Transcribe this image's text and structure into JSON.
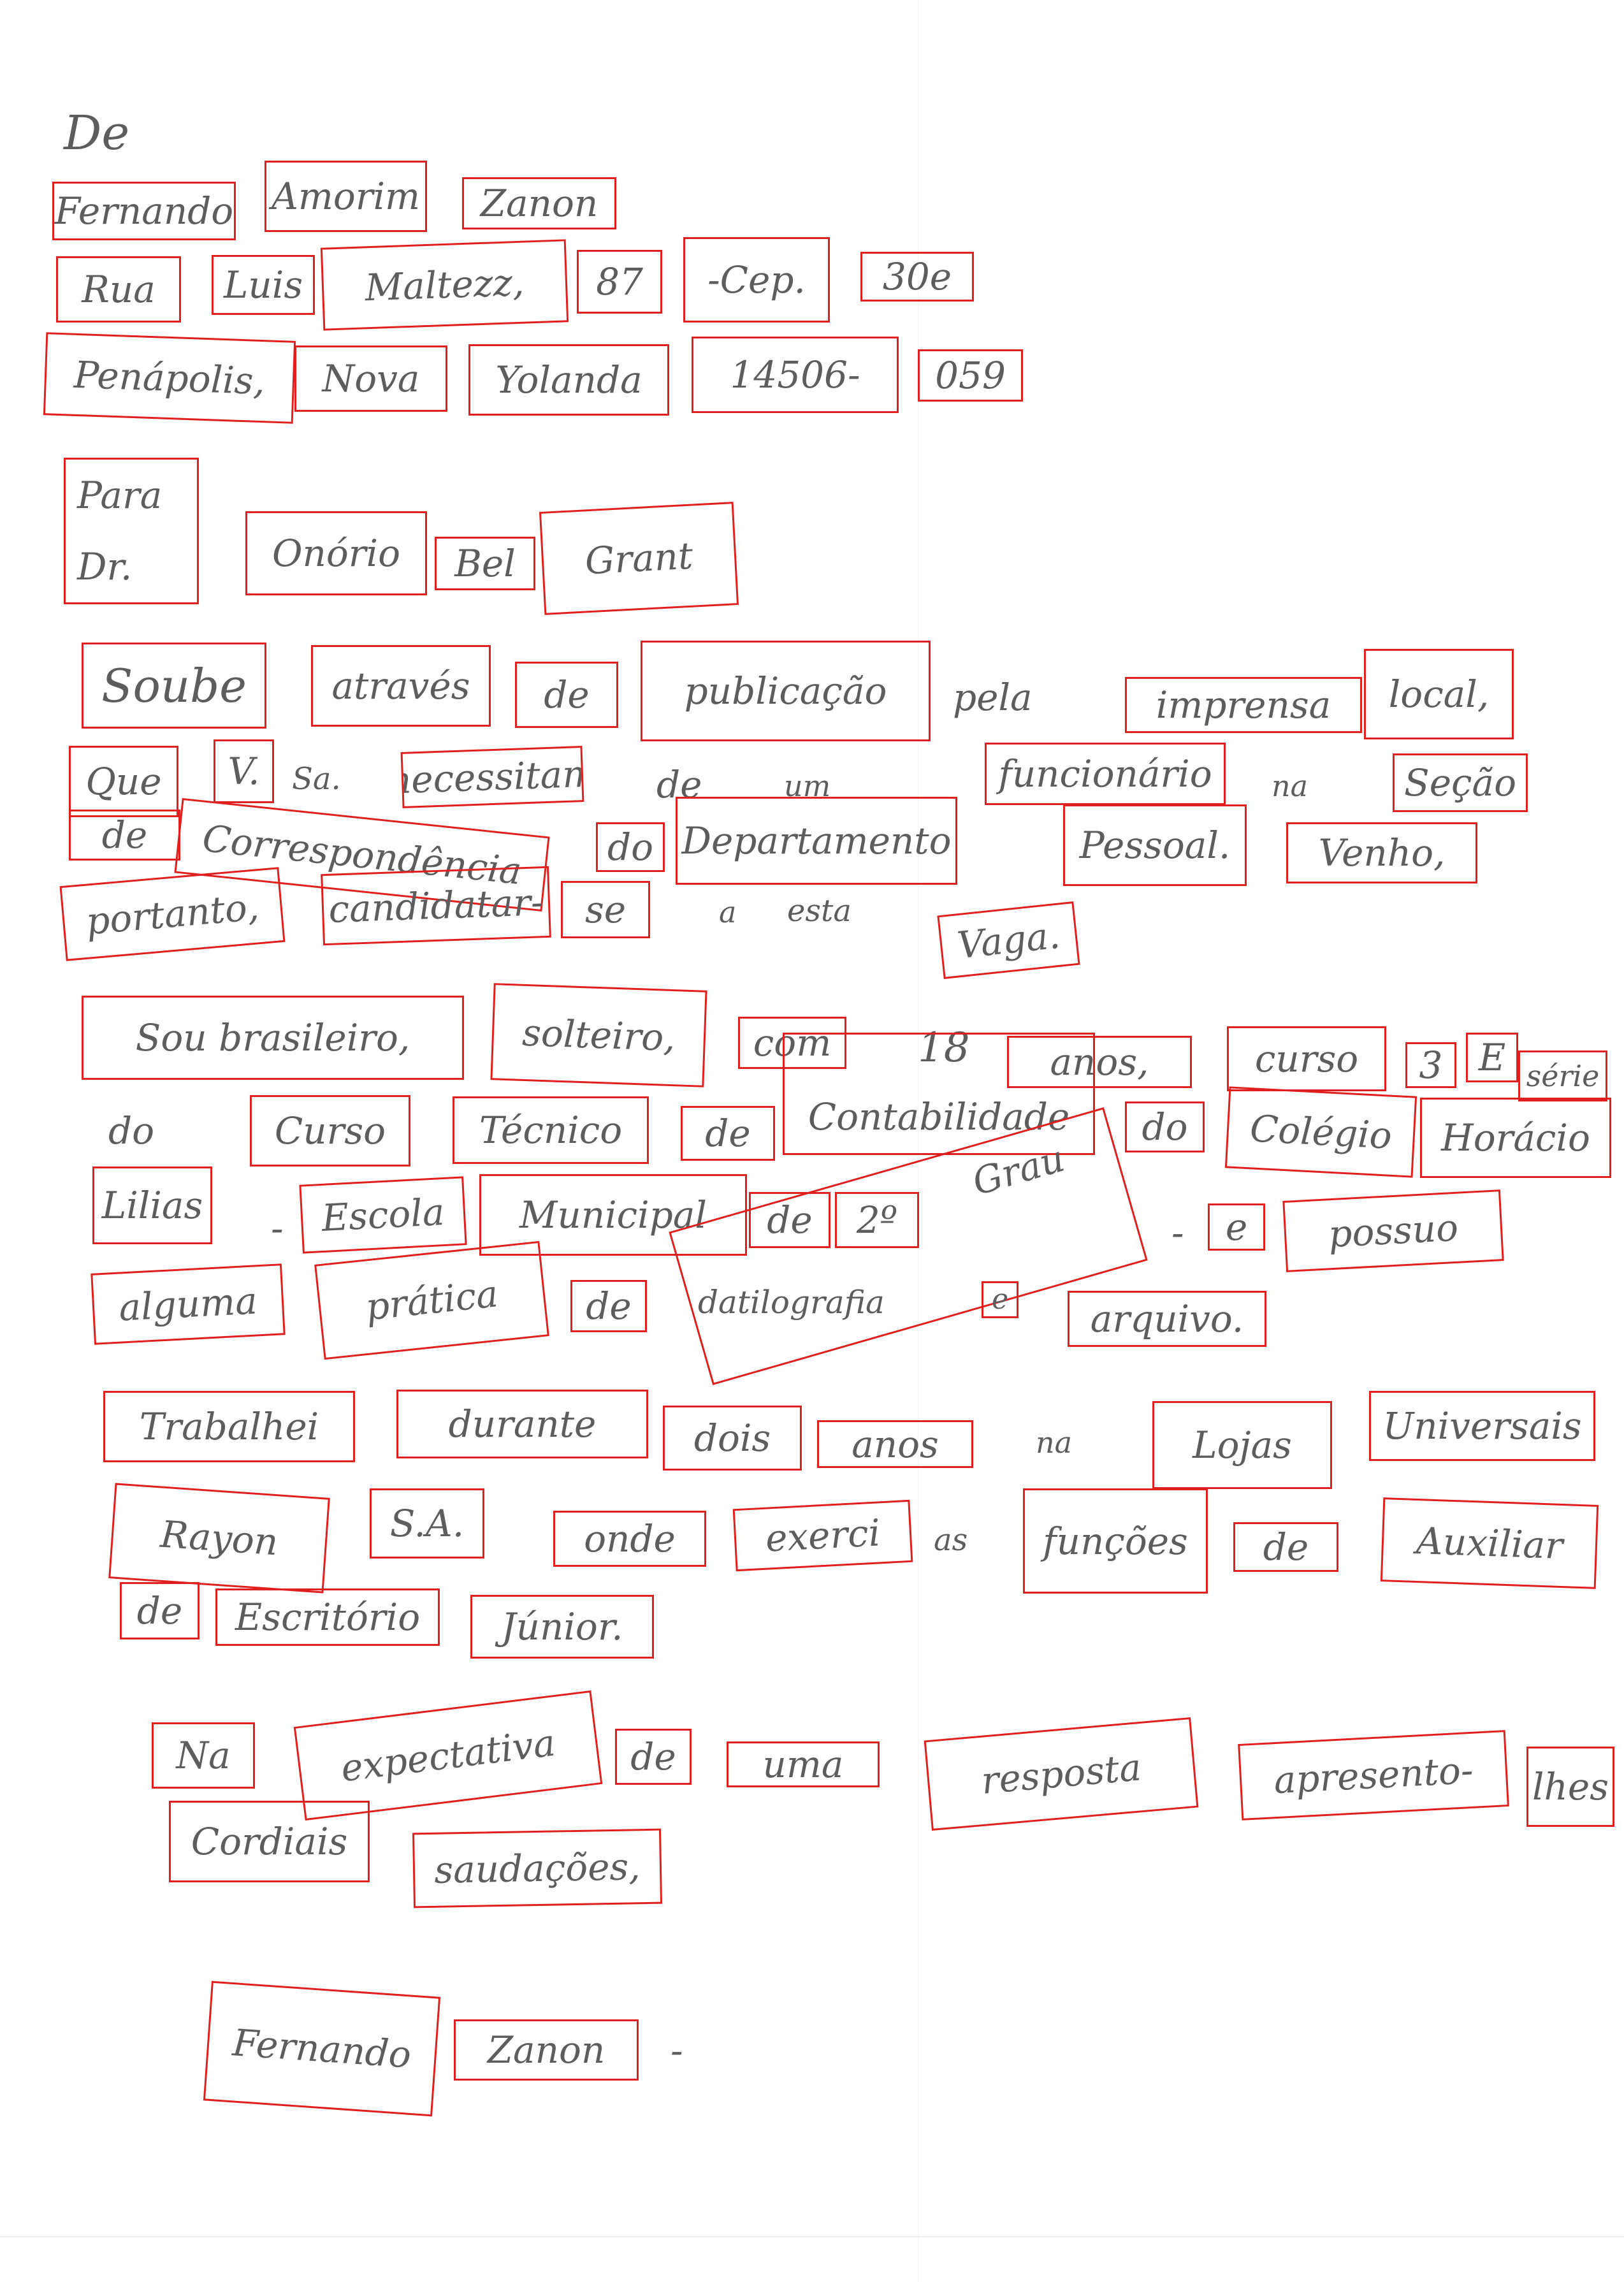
{
  "letter": {
    "sender": {
      "greeting": "De",
      "name_words": [
        "Fernando",
        "Amorim",
        "Zanon"
      ],
      "street_words": [
        "Rua",
        "Luis",
        "Maltezz,",
        "87",
        "-Cep.",
        "30e"
      ],
      "city_words": [
        "Penápolis,",
        "Nova",
        "Yolanda",
        "14506-",
        "059"
      ]
    },
    "recipient": {
      "to_words": [
        "Para",
        "Dr.",
        "Onório",
        "Bel",
        "Grant"
      ]
    },
    "paragraph1": {
      "words": [
        "Soube",
        "através",
        "de",
        "publicação",
        "pela",
        "imprensa",
        "local,",
        "Que",
        "V.",
        "Sa.",
        "necessitam",
        "de",
        "um",
        "funcionário",
        "na",
        "Seção",
        "de",
        "Correspondência",
        "do",
        "Departamento",
        "Pessoal.",
        "Venho,",
        "portanto,",
        "candidatar-",
        "se",
        "a",
        "esta",
        "Vaga."
      ]
    },
    "paragraph2": {
      "words": [
        "Sou",
        "brasileiro,",
        "solteiro,",
        "com",
        "18",
        "anos,",
        "curso",
        "3",
        "E",
        "série",
        "do",
        "Curso",
        "Técnico",
        "de",
        "Contabilidade",
        "do",
        "Colégio",
        "Horácio",
        "Lilias",
        "-",
        "Escola",
        "Municipal",
        "de",
        "2º",
        "Grau",
        "-",
        "e",
        "possuo",
        "alguma",
        "prática",
        "de",
        "datilografia",
        "e",
        "arquivo."
      ]
    },
    "paragraph3": {
      "words": [
        "Trabalhei",
        "durante",
        "dois",
        "anos",
        "na",
        "Lojas",
        "Universais",
        "Rayon",
        "S.A.",
        "onde",
        "exerci",
        "as",
        "funções",
        "de",
        "Auxiliar",
        "de",
        "Escritório",
        "Júnior."
      ]
    },
    "paragraph4": {
      "words": [
        "Na",
        "expectativa",
        "de",
        "uma",
        "resposta",
        "apresento-",
        "lhes",
        "Cordiais",
        "saudações,"
      ]
    },
    "signature": {
      "words": [
        "Fernando",
        "Zanon",
        "-"
      ]
    }
  },
  "colors": {
    "ink": "#5d5d5d",
    "box": "#e0201e",
    "paper": "#ffffff"
  }
}
